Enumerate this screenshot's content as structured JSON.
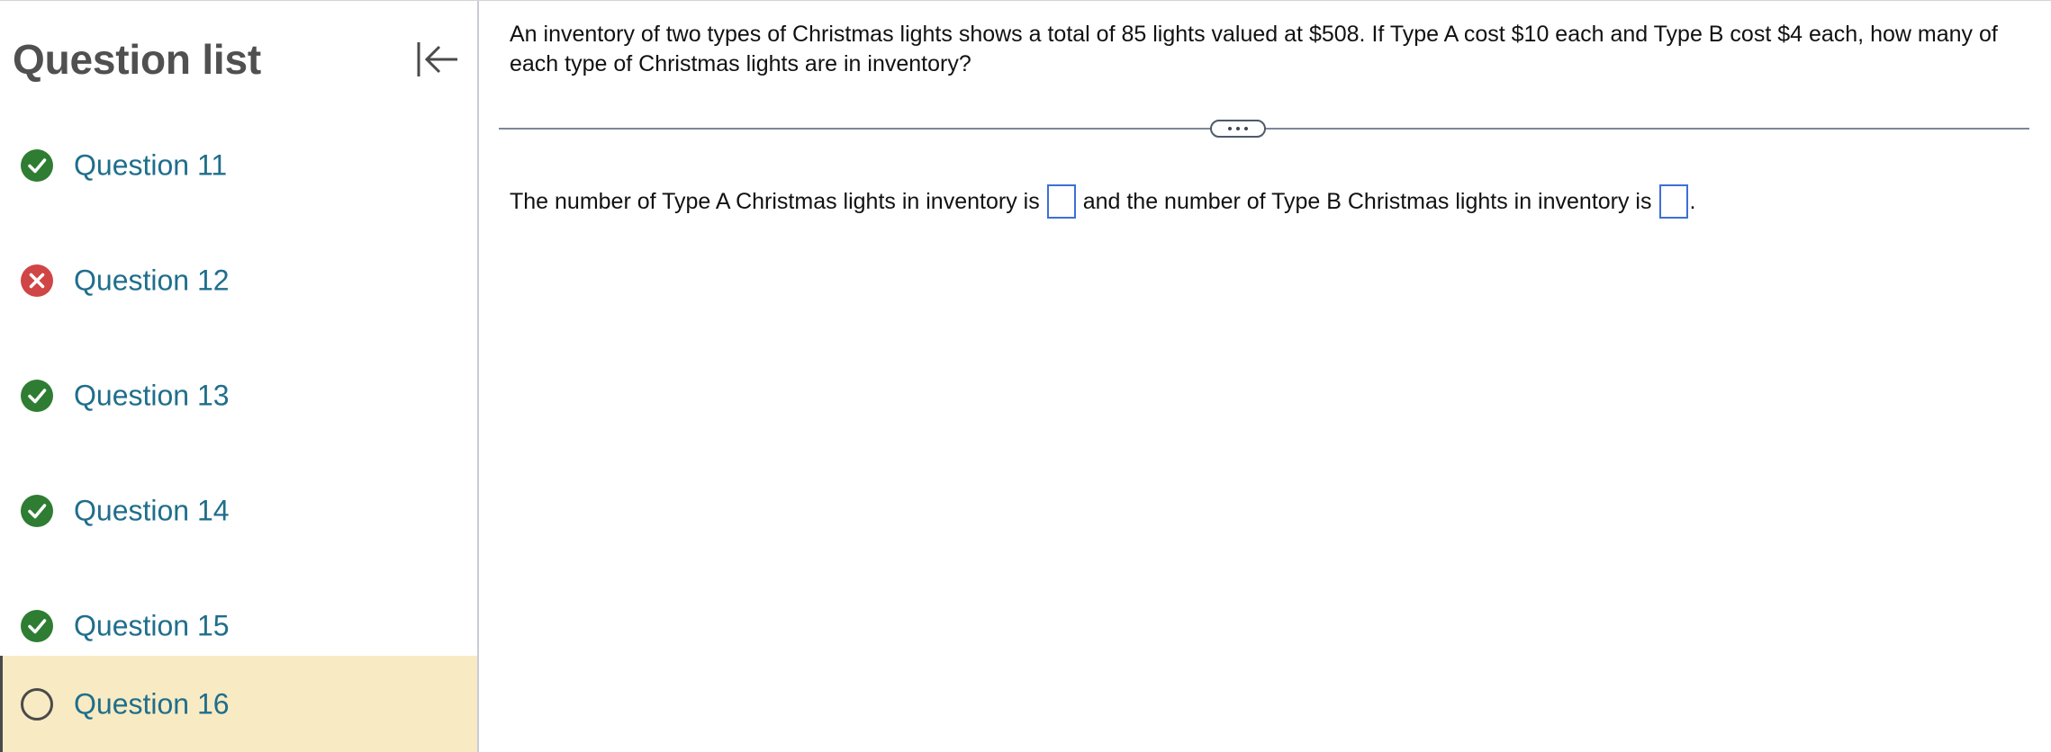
{
  "sidebar": {
    "title": "Question list",
    "questions": [
      {
        "label": "Question 11",
        "status": "correct"
      },
      {
        "label": "Question 12",
        "status": "incorrect"
      },
      {
        "label": "Question 13",
        "status": "correct"
      },
      {
        "label": "Question 14",
        "status": "correct"
      },
      {
        "label": "Question 15",
        "status": "correct"
      },
      {
        "label": "Question 16",
        "status": "unanswered"
      }
    ],
    "active_question": "Question 16"
  },
  "colors": {
    "correct": "#2e7d32",
    "incorrect": "#d04545",
    "active_bg": "#f8ebc3",
    "link": "#1f6e8c",
    "input_border": "#3d6fd6"
  },
  "question": {
    "text": "An inventory of two types of Christmas lights shows a total of 85 lights valued at $508. If Type A cost $10 each and Type B cost $4 each, how many of each type of Christmas lights are in inventory?",
    "answer_part1": "The number of Type A Christmas lights in inventory is",
    "answer_part2": "and the number of Type B Christmas lights in inventory is",
    "answer_end": ".",
    "answer_a_value": "",
    "answer_b_value": ""
  }
}
